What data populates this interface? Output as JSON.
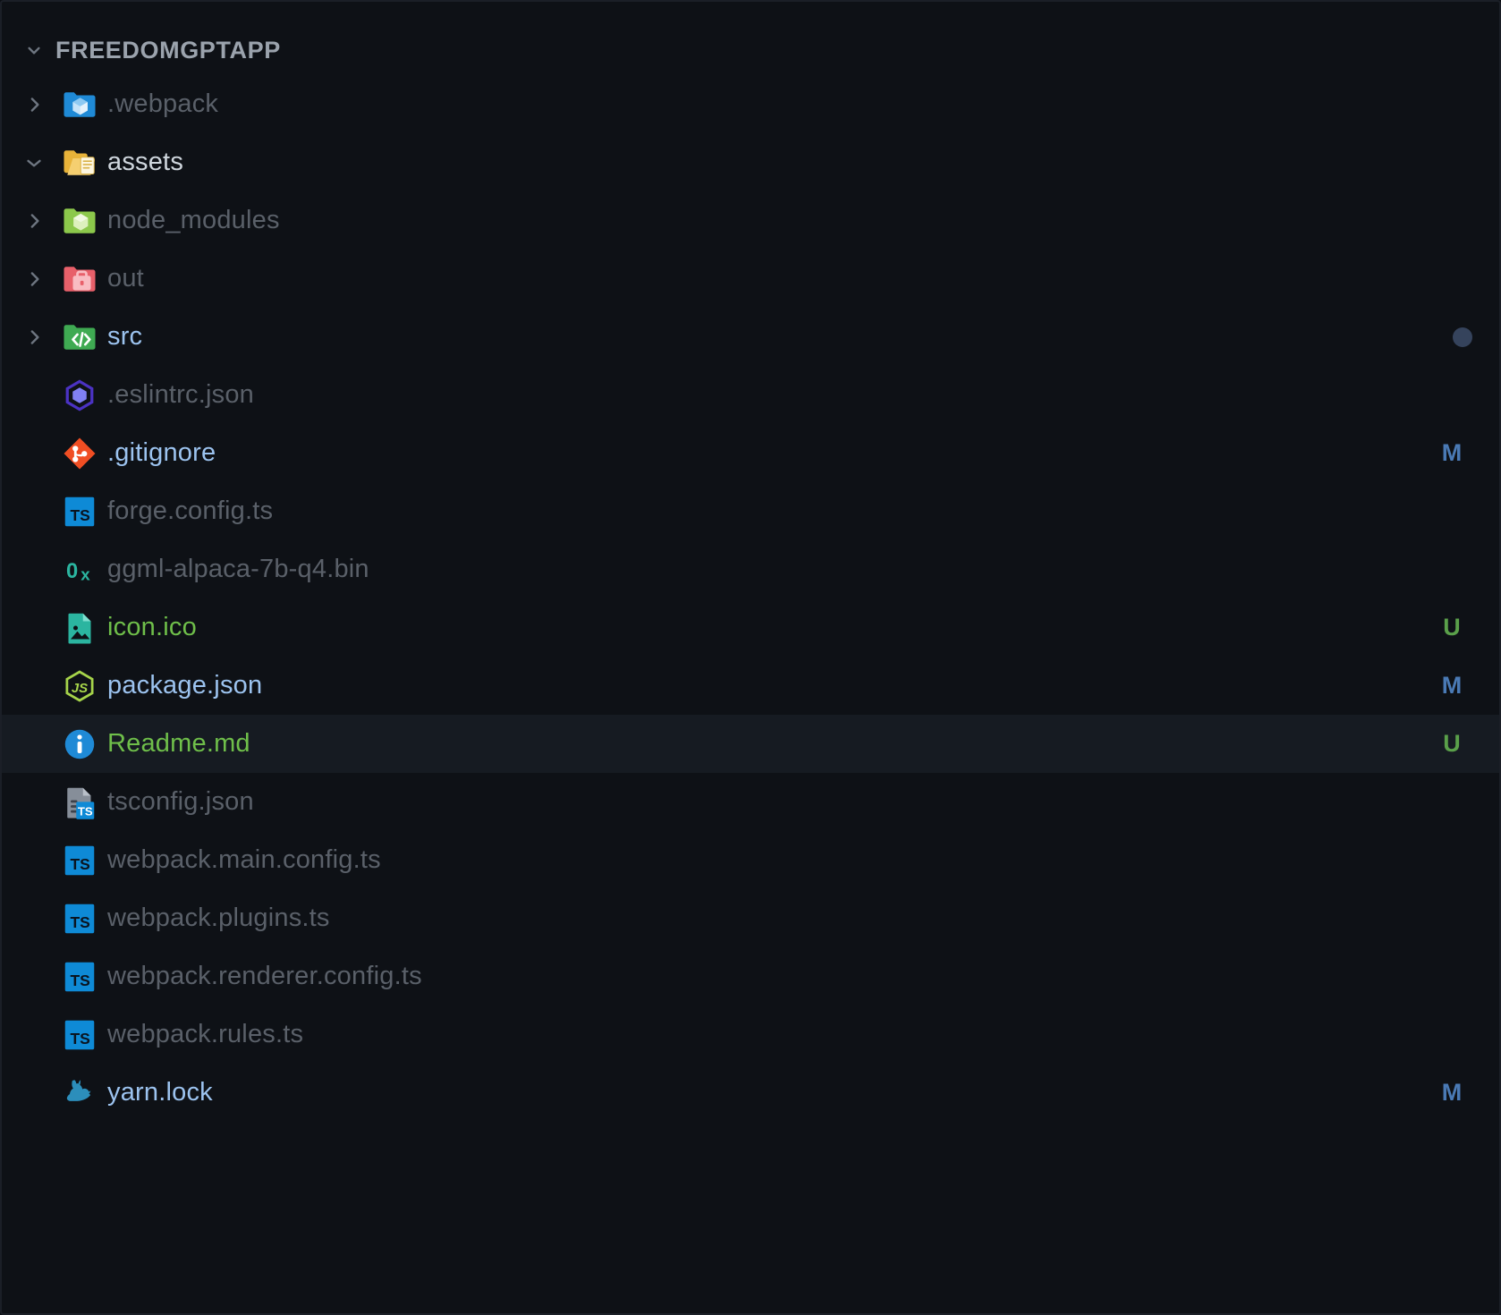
{
  "explorer": {
    "section_title": "FREEDOMGPTAPP",
    "section_state": "expanded",
    "colors": {
      "background": "#0e1116",
      "selected_row": "#161b22",
      "text": "#cfd6dd",
      "text_dim": "#5a6069",
      "modified": "#4a7ab5",
      "untracked": "#5aa04a",
      "folder_blue": "#1f8ad6",
      "folder_yellow": "#e8b339",
      "folder_green": "#8cc84b",
      "folder_red": "#e8606a",
      "folder_src_green": "#3faa52"
    },
    "items": [
      {
        "name": ".webpack",
        "type": "folder",
        "icon": "folder-webpack-icon",
        "twisty": "collapsed",
        "dim": true,
        "badge": "",
        "selected": false
      },
      {
        "name": "assets",
        "type": "folder",
        "icon": "folder-assets-icon",
        "twisty": "expanded",
        "dim": false,
        "badge": "",
        "selected": false
      },
      {
        "name": "node_modules",
        "type": "folder",
        "icon": "folder-node-icon",
        "twisty": "collapsed",
        "dim": true,
        "badge": "",
        "selected": false
      },
      {
        "name": "out",
        "type": "folder",
        "icon": "folder-out-icon",
        "twisty": "collapsed",
        "dim": true,
        "badge": "",
        "selected": false
      },
      {
        "name": "src",
        "type": "folder",
        "icon": "folder-src-icon",
        "twisty": "collapsed",
        "dim": false,
        "badge": "dot",
        "selected": false,
        "link": true
      },
      {
        "name": ".eslintrc.json",
        "type": "file",
        "icon": "eslint-icon",
        "twisty": "none",
        "dim": true,
        "badge": "",
        "selected": false
      },
      {
        "name": ".gitignore",
        "type": "file",
        "icon": "git-icon",
        "twisty": "none",
        "dim": false,
        "badge": "M",
        "selected": false,
        "link": true
      },
      {
        "name": "forge.config.ts",
        "type": "file",
        "icon": "typescript-icon",
        "twisty": "none",
        "dim": true,
        "badge": "",
        "selected": false
      },
      {
        "name": "ggml-alpaca-7b-q4.bin",
        "type": "file",
        "icon": "binary-icon",
        "twisty": "none",
        "dim": true,
        "badge": "",
        "selected": false
      },
      {
        "name": "icon.ico",
        "type": "file",
        "icon": "image-icon",
        "twisty": "none",
        "dim": false,
        "badge": "U",
        "selected": false,
        "untracked": true
      },
      {
        "name": "package.json",
        "type": "file",
        "icon": "nodejs-json-icon",
        "twisty": "none",
        "dim": false,
        "badge": "M",
        "selected": false,
        "link": true
      },
      {
        "name": "Readme.md",
        "type": "file",
        "icon": "info-circle-icon",
        "twisty": "none",
        "dim": false,
        "badge": "U",
        "selected": true,
        "untracked": true
      },
      {
        "name": "tsconfig.json",
        "type": "file",
        "icon": "tsconfig-icon",
        "twisty": "none",
        "dim": true,
        "badge": "",
        "selected": false
      },
      {
        "name": "webpack.main.config.ts",
        "type": "file",
        "icon": "typescript-icon",
        "twisty": "none",
        "dim": true,
        "badge": "",
        "selected": false
      },
      {
        "name": "webpack.plugins.ts",
        "type": "file",
        "icon": "typescript-icon",
        "twisty": "none",
        "dim": true,
        "badge": "",
        "selected": false
      },
      {
        "name": "webpack.renderer.config.ts",
        "type": "file",
        "icon": "typescript-icon",
        "twisty": "none",
        "dim": true,
        "badge": "",
        "selected": false
      },
      {
        "name": "webpack.rules.ts",
        "type": "file",
        "icon": "typescript-icon",
        "twisty": "none",
        "dim": true,
        "badge": "",
        "selected": false
      },
      {
        "name": "yarn.lock",
        "type": "file",
        "icon": "yarn-icon",
        "twisty": "none",
        "dim": false,
        "badge": "M",
        "selected": false,
        "link": true
      }
    ]
  }
}
